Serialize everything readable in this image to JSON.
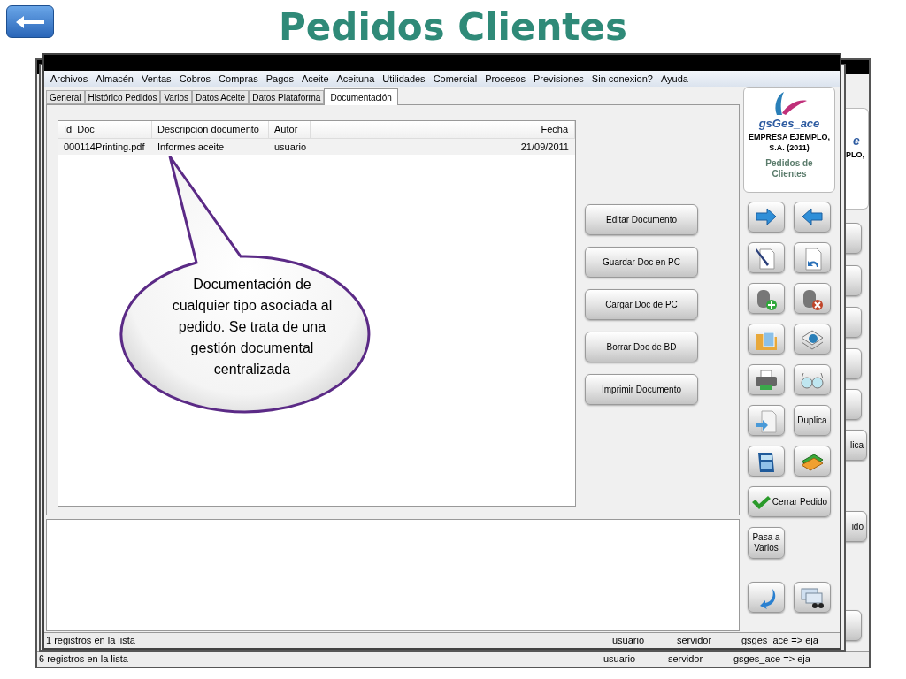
{
  "slide": {
    "title": "Pedidos Clientes"
  },
  "back_window": {
    "card_texts": [
      "e",
      "PLO,"
    ],
    "button_texts": [
      "lica",
      "ido"
    ],
    "status_bar": [
      "6 registros en la lista",
      "usuario",
      "servidor",
      "gsges_ace => eja"
    ]
  },
  "window": {
    "menu": [
      "Archivos",
      "Almacén",
      "Ventas",
      "Cobros",
      "Compras",
      "Pagos",
      "Aceite",
      "Aceituna",
      "Utilidades",
      "Comercial",
      "Procesos",
      "Previsiones",
      "Sin conexion?",
      "Ayuda"
    ],
    "tabs": [
      {
        "label": "General",
        "selected": false
      },
      {
        "label": "Histórico Pedidos",
        "selected": false
      },
      {
        "label": "Varios",
        "selected": false
      },
      {
        "label": "Datos Aceite",
        "selected": false
      },
      {
        "label": "Datos Plataforma",
        "selected": false
      },
      {
        "label": "Documentación",
        "selected": true
      }
    ],
    "table": {
      "columns": [
        "Id_Doc",
        "Descripcion documento",
        "Autor",
        "Fecha"
      ],
      "rows": [
        [
          "000114Printing.pdf",
          "Informes aceite",
          "usuario",
          "21/09/2011"
        ]
      ]
    },
    "doc_buttons": [
      "Editar Documento",
      "Guardar Doc en PC",
      "Cargar Doc de PC",
      "Borrar Doc de BD",
      "Imprimir Documento"
    ],
    "panel": {
      "app_name": "gsGes_ace",
      "company": "EMPRESA EJEMPLO, S.A. (2011)",
      "module": "Pedidos de Clientes"
    },
    "tool_buttons": [
      {
        "kind": "icon"
      },
      {
        "kind": "icon"
      },
      {
        "kind": "icon"
      },
      {
        "kind": "icon"
      },
      {
        "kind": "icon"
      },
      {
        "kind": "icon"
      },
      {
        "kind": "icon"
      },
      {
        "kind": "icon"
      },
      {
        "kind": "icon"
      },
      {
        "kind": "icon"
      },
      {
        "kind": "icon"
      },
      {
        "kind": "text",
        "label": "Duplica"
      },
      {
        "kind": "icon"
      },
      {
        "kind": "icon"
      }
    ],
    "close_button": "Cerrar Pedido",
    "pass_button": "Pasa a Varios",
    "bottom_buttons": [
      {
        "kind": "icon"
      },
      {
        "kind": "icon"
      }
    ],
    "status_bar": [
      "1 registros en la lista",
      "usuario",
      "servidor",
      "gsges_ace => eja"
    ]
  },
  "callout": "Documentación de cualquier tipo asociada al pedido. Se trata de una gestión documental centralizada"
}
